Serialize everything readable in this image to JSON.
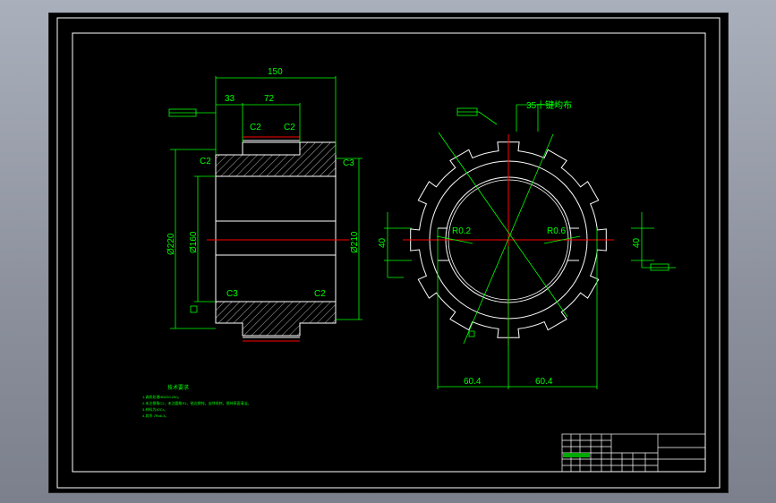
{
  "drawing": {
    "overall_length": "150",
    "step_left": "33",
    "step_right": "72",
    "chamfer_c2_a": "C2",
    "chamfer_c2_b": "C2",
    "chamfer_c2_c": "C2",
    "chamfer_c3_a": "C3",
    "chamfer_c3_b": "C3",
    "chamfer_c2_d": "C2",
    "dia_outer": "Ø220",
    "dia_bore": "Ø160",
    "dia_right": "Ø210",
    "spline_callout": "35十键均布",
    "radius_left": "R0.2",
    "radius_right": "R0.6",
    "dim_40_left": "40",
    "dim_40_right": "40",
    "half_width_left": "60.4",
    "half_width_right": "60.4",
    "tech_req_title": "技术要求",
    "tech_req_lines": [
      "1.调质处理HB220-250。",
      "2.未注倒角C2，未注圆角R1，锐边倒钝，去除毛刺，保持表面清洁。",
      "3.材料为40Cr。",
      "4.其余 √Ra6.3。"
    ]
  },
  "colors": {
    "geometry": "#ffffff",
    "dimensions": "#00ff00",
    "centerline": "#ff0000",
    "background": "#000000"
  }
}
